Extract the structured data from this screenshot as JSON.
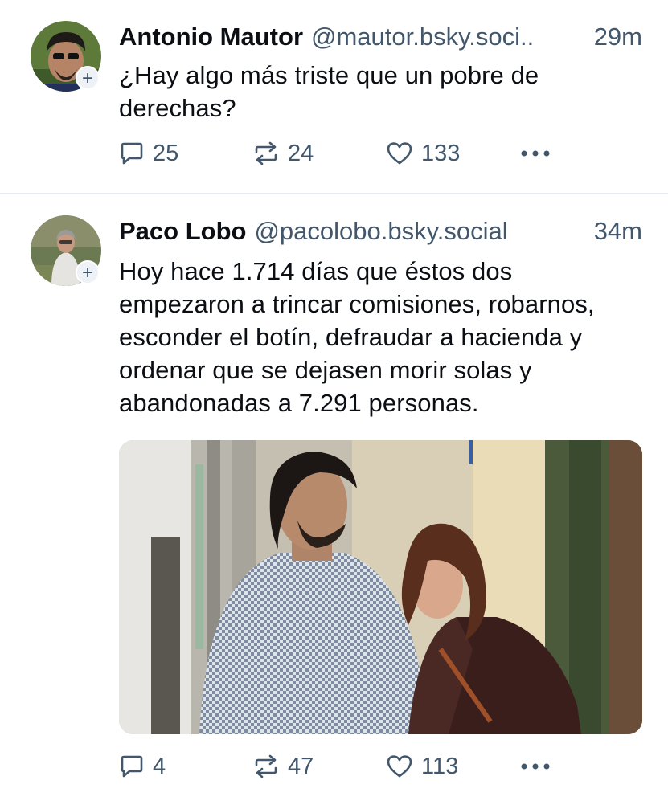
{
  "posts": [
    {
      "author": {
        "display_name": "Antonio Mautor",
        "handle": "@mautor.bsky.soci.."
      },
      "time": "29m",
      "text": "¿Hay algo más triste que un pobre de derechas?",
      "stats": {
        "replies": "25",
        "reposts": "24",
        "likes": "133"
      },
      "follow_badge": "+",
      "avatar_icon": "avatar-photo"
    },
    {
      "author": {
        "display_name": "Paco Lobo",
        "handle": "@pacolobo.bsky.social"
      },
      "time": "34m",
      "text": "Hoy hace 1.714 días que éstos dos empezaron a trincar comisiones, robarnos, esconder el botín, defraudar a hacienda y ordenar que se dejasen morir solas y abandonadas a 7.291 personas.",
      "stats": {
        "replies": "4",
        "reposts": "47",
        "likes": "113"
      },
      "follow_badge": "+",
      "avatar_icon": "avatar-photo",
      "media": {
        "type": "photo",
        "subject": "street-photo"
      }
    }
  ],
  "icons": {
    "reply": "reply-icon",
    "repost": "repost-icon",
    "like": "heart-icon",
    "more": "more-icon"
  },
  "colors": {
    "text": "#0b0f14",
    "muted": "#42576c",
    "divider": "#e8ecf0",
    "background": "#ffffff"
  }
}
